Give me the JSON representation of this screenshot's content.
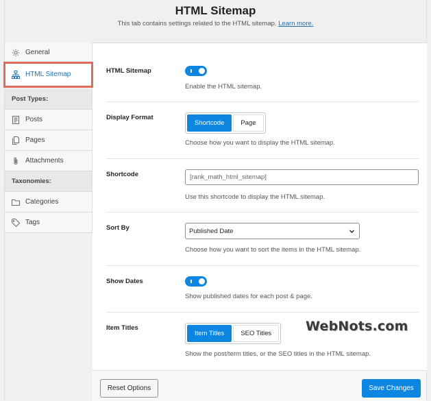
{
  "header": {
    "title": "HTML Sitemap",
    "subtitle": "This tab contains settings related to the HTML sitemap.",
    "learn_more": "Learn more."
  },
  "sidebar": {
    "items": [
      {
        "label": "General",
        "icon": "gear-icon"
      },
      {
        "label": "HTML Sitemap",
        "icon": "sitemap-icon",
        "active": true
      }
    ],
    "post_types_heading": "Post Types:",
    "post_types": [
      {
        "label": "Posts",
        "icon": "posts-icon"
      },
      {
        "label": "Pages",
        "icon": "pages-icon"
      },
      {
        "label": "Attachments",
        "icon": "paperclip-icon"
      }
    ],
    "taxonomies_heading": "Taxonomies:",
    "taxonomies": [
      {
        "label": "Categories",
        "icon": "folder-icon"
      },
      {
        "label": "Tags",
        "icon": "tag-icon"
      }
    ]
  },
  "settings": {
    "html_sitemap": {
      "label": "HTML Sitemap",
      "enabled": true,
      "desc": "Enable the HTML sitemap."
    },
    "display_format": {
      "label": "Display Format",
      "options": [
        "Shortcode",
        "Page"
      ],
      "selected": "Shortcode",
      "desc": "Choose how you want to display the HTML sitemap."
    },
    "shortcode": {
      "label": "Shortcode",
      "value": "[rank_math_html_sitemap]",
      "desc": "Use this shortcode to display the HTML sitemap."
    },
    "sort_by": {
      "label": "Sort By",
      "value": "Published Date",
      "desc": "Choose how you want to sort the items in the HTML sitemap."
    },
    "show_dates": {
      "label": "Show Dates",
      "enabled": true,
      "desc": "Show published dates for each post & page."
    },
    "item_titles": {
      "label": "Item Titles",
      "options": [
        "Item Titles",
        "SEO Titles"
      ],
      "selected": "Item Titles",
      "desc": "Show the post/term titles, or the SEO titles in the HTML sitemap."
    }
  },
  "footer": {
    "reset_label": "Reset Options",
    "save_label": "Save Changes"
  },
  "watermark": "WebNots.com",
  "colors": {
    "accent": "#0c86e0",
    "highlight": "#e26a5b",
    "link": "#2271b1"
  }
}
